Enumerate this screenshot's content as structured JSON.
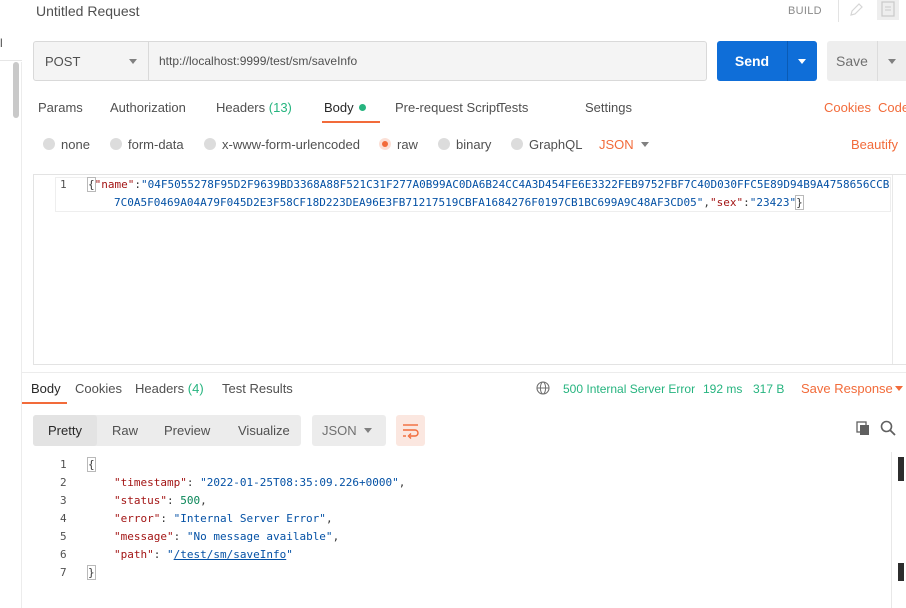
{
  "left_sliver": {
    "mark": "l"
  },
  "header": {
    "title": "Untitled Request",
    "build_label": "BUILD"
  },
  "request": {
    "method": "POST",
    "url": "http://localhost:9999/test/sm/saveInfo",
    "send_label": "Send",
    "save_label": "Save"
  },
  "request_tabs": {
    "params": "Params",
    "authorization": "Authorization",
    "headers": "Headers",
    "headers_count": "(13)",
    "body": "Body",
    "pre_request": "Pre-request Script",
    "tests": "Tests",
    "settings": "Settings",
    "cookies": "Cookies",
    "code": "Code"
  },
  "body_types": {
    "none": "none",
    "form_data": "form-data",
    "urlencoded": "x-www-form-urlencoded",
    "raw": "raw",
    "binary": "binary",
    "graphql": "GraphQL",
    "format": "JSON",
    "beautify": "Beautify",
    "selected": "raw"
  },
  "request_body": {
    "line_numbers": [
      "1"
    ],
    "open": "{",
    "name_key": "\"name\"",
    "name_value_part1": "\"04F5055278F95D2F9639BD3368A88F521C31F277A0B99AC0DA6B24CC4A3D454FE6E3322FEB9752FBF7C40D030FFC5E89D94B9A4758656CCB",
    "name_value_part2": "7C0A5F0469A04A79F045D2E3F58CF18D223DEA96E3FB71217519CBFA1684276F0197CB1BC699A9C48AF3CD05\"",
    "sex_key": "\"sex\"",
    "sex_value": "\"23423\"",
    "close": "}"
  },
  "response_tabs": {
    "body": "Body",
    "cookies": "Cookies",
    "headers": "Headers",
    "headers_count": "(4)",
    "test_results": "Test Results"
  },
  "response_status": {
    "status": "500 Internal Server Error",
    "time": "192 ms",
    "size": "317 B",
    "save_response": "Save Response"
  },
  "response_toolbar": {
    "pretty": "Pretty",
    "raw": "Raw",
    "preview": "Preview",
    "visualize": "Visualize",
    "format": "JSON"
  },
  "response_body": {
    "line_numbers": [
      "1",
      "2",
      "3",
      "4",
      "5",
      "6",
      "7"
    ],
    "open": "{",
    "timestamp_key": "\"timestamp\"",
    "timestamp_value": "\"2022-01-25T08:35:09.226+0000\"",
    "status_key": "\"status\"",
    "status_value": "500",
    "error_key": "\"error\"",
    "error_value": "\"Internal Server Error\"",
    "message_key": "\"message\"",
    "message_value": "\"No message available\"",
    "path_key": "\"path\"",
    "path_quote_open": "\"",
    "path_value": "/test/sm/saveInfo",
    "path_quote_close": "\"",
    "close": "}"
  },
  "colors": {
    "accent": "#f26b3a",
    "send_blue": "#0f6ed8",
    "status_green": "#26b47f",
    "json_key": "#a31515",
    "json_string": "#0451a5"
  },
  "icons": [
    "pencil-icon",
    "document-icon",
    "caret-down-icon",
    "globe-icon",
    "copy-icon",
    "search-icon",
    "wrap-lines-icon"
  ]
}
